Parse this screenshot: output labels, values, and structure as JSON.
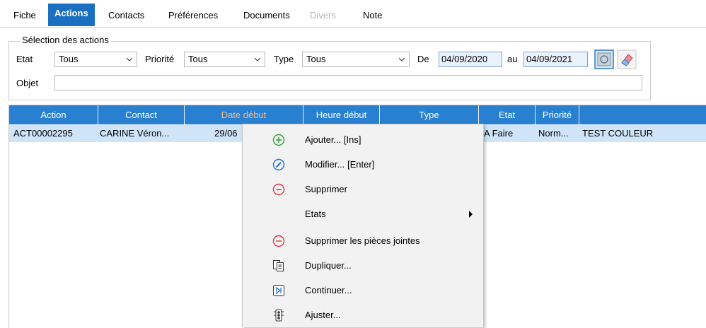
{
  "tabs": [
    {
      "label": "Fiche"
    },
    {
      "label": "Actions"
    },
    {
      "label": "Contacts"
    },
    {
      "label": "Préférences"
    },
    {
      "label": "Documents"
    },
    {
      "label": "Divers"
    },
    {
      "label": "Note"
    }
  ],
  "active_tab": "Actions",
  "selection": {
    "legend": "Sélection des actions",
    "etat": {
      "label": "Etat",
      "value": "Tous"
    },
    "priorite": {
      "label": "Priorité",
      "value": "Tous"
    },
    "type": {
      "label": "Type",
      "value": "Tous"
    },
    "de": {
      "label": "De",
      "value": "04/09/2020"
    },
    "au": {
      "label": "au",
      "value": "04/09/2021"
    },
    "objet": {
      "label": "Objet",
      "value": ""
    },
    "refresh_icon": "refresh-icon",
    "eraser_icon": "eraser-icon"
  },
  "grid": {
    "columns": [
      "Action",
      "Contact",
      "Date début",
      "Heure début",
      "Type",
      "Etat",
      "Priorité",
      ""
    ],
    "sorted_column": "Date début",
    "rows": [
      [
        "ACT00002295",
        "CARINE Véron...",
        "29/06",
        "",
        "",
        "A Faire",
        "Norm...",
        "TEST COULEUR"
      ]
    ]
  },
  "context_menu": {
    "items": [
      {
        "label": "Ajouter... [Ins]",
        "icon": "add-circle-icon"
      },
      {
        "label": "Modifier... [Enter]",
        "icon": "edit-pencil-circle-icon"
      },
      {
        "label": "Supprimer",
        "icon": "remove-circle-icon"
      },
      {
        "label": "Etats",
        "icon": "",
        "submenu": true
      },
      {
        "label": "Supprimer les pièces jointes",
        "icon": "remove-circle-icon"
      },
      {
        "label": "Dupliquer...",
        "icon": "duplicate-document-icon"
      },
      {
        "label": "Continuer...",
        "icon": "continue-step-icon"
      },
      {
        "label": "Ajuster...",
        "icon": "adjust-traffic-light-icon"
      }
    ]
  },
  "colors": {
    "header_blue": "#2a80d0",
    "active_tab_blue": "#1a6fc1",
    "selected_row": "#cfe4f7",
    "sorted_header_text": "#f7b78a",
    "add_green": "#2ca02c",
    "edit_blue": "#1f6fd1",
    "remove_red": "#d9363e"
  }
}
